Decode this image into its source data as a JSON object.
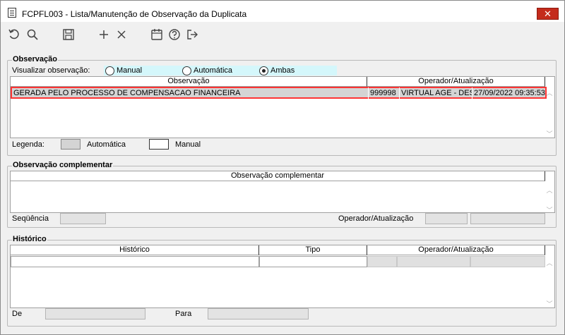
{
  "window": {
    "title": "FCPFL003 - Lista/Manutenção de Observação da Duplicata",
    "close_label": "✕"
  },
  "toolbar": {
    "buttons": [
      {
        "name": "refresh-icon"
      },
      {
        "name": "search-icon"
      },
      {
        "name": "save-icon"
      },
      {
        "name": "add-icon"
      },
      {
        "name": "delete-icon"
      },
      {
        "name": "calendar-icon"
      },
      {
        "name": "help-icon"
      },
      {
        "name": "exit-icon"
      }
    ]
  },
  "observacao": {
    "group_title": "Observação",
    "visualizar_label": "Visualizar observação:",
    "radios": [
      {
        "label": "Manual",
        "checked": false
      },
      {
        "label": "Automática",
        "checked": false
      },
      {
        "label": "Ambas",
        "checked": true
      }
    ],
    "columns": [
      "Observação",
      "Operador/Atualização"
    ],
    "rows": [
      {
        "obs": "GERADA PELO PROCESSO DE COMPENSACAO FINANCEIRA",
        "cod": "999998",
        "operador": "VIRTUAL AGE - DESE",
        "data": "27/09/2022 09:35:53"
      }
    ],
    "legenda_label": "Legenda:",
    "legenda_auto": "Automática",
    "legenda_manual": "Manual",
    "colors": {
      "highlight": "#ff3333",
      "auto_bg": "#d4d4d4",
      "radio_bg": "#d4f7fb"
    }
  },
  "complementar": {
    "group_title": "Observação complementar",
    "column": "Observação complementar",
    "sequencia_label": "Seqüência",
    "operador_label": "Operador/Atualização"
  },
  "historico": {
    "group_title": "Histórico",
    "columns": [
      "Histórico",
      "Tipo",
      "Operador/Atualização"
    ],
    "de_label": "De",
    "para_label": "Para"
  }
}
